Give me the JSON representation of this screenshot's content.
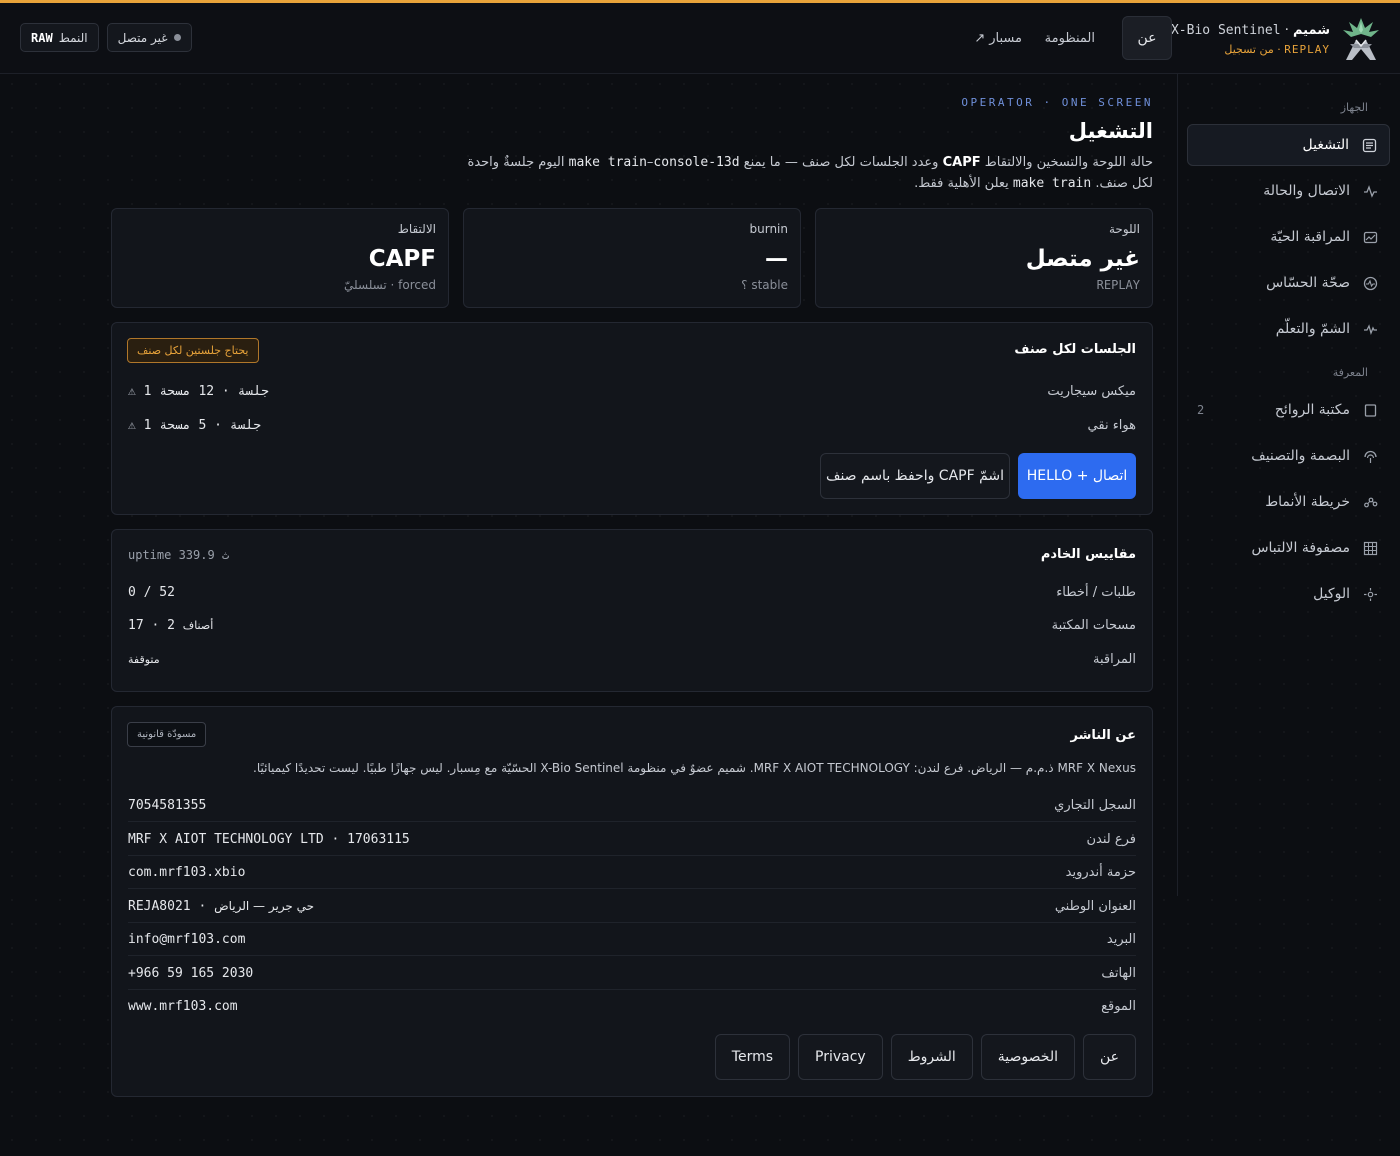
{
  "header": {
    "brand_name": "شميم",
    "brand_separator": "·",
    "brand_product": "X-Bio Sentinel",
    "brand_mode": "REPLAY",
    "brand_mode_sep": "·",
    "brand_mode_note": "من تسجيل",
    "nav_about": "عن",
    "nav_ecosystem": "المنظومة",
    "nav_masar": "مسبار",
    "nav_masar_icon": "↗",
    "status_chip": "غير متصل",
    "mode_chip_label": "النمط",
    "mode_chip_value": "RAW"
  },
  "sidebar": {
    "section_device": "الجهاز",
    "section_knowledge": "المعرفة",
    "items": [
      {
        "label": "التشغيل",
        "icon": "operation-icon"
      },
      {
        "label": "الاتصال والحالة",
        "icon": "pulse-icon"
      },
      {
        "label": "المراقبة الحيّة",
        "icon": "chart-icon"
      },
      {
        "label": "صحّة الحسّاس",
        "icon": "health-icon"
      },
      {
        "label": "الشمّ والتعلّم",
        "icon": "sparkle-icon"
      },
      {
        "label": "مكتبة الروائح",
        "icon": "library-icon",
        "count": "2"
      },
      {
        "label": "البصمة والتصنيف",
        "icon": "fingerprint-icon"
      },
      {
        "label": "خريطة الأنماط",
        "icon": "pattern-icon"
      },
      {
        "label": "مصفوفة الالتباس",
        "icon": "grid-icon"
      },
      {
        "label": "الوكيل",
        "icon": "agent-icon"
      }
    ]
  },
  "page": {
    "eyebrow": "OPERATOR · ONE SCREEN",
    "title": "التشغيل",
    "lead_p1": "حالة اللوحة والتسخين والالتقاط ",
    "lead_bold": "CAPF",
    "lead_p2": " وعدد الجلسات لكل صنف — ما يمنع ",
    "lead_code1": "make train",
    "lead_p3": "–",
    "lead_code2": "console-13d",
    "lead_p4": " اليوم جلسةٌ واحدة لكل صنف. ",
    "lead_code3": "make train",
    "lead_p5": " يعلن الأهلية فقط."
  },
  "stats": {
    "board": {
      "label": "اللوحة",
      "value": "غير متصل",
      "sub": "REPLAY"
    },
    "burnin": {
      "label": "burnin",
      "value": "—",
      "sub": "stable ؟"
    },
    "capture": {
      "label": "الالتقاط",
      "value": "CAPF",
      "sub": "forced · تسلسليّ"
    }
  },
  "sessions": {
    "title": "الجلسات لكل صنف",
    "badge": "يحتاج جلستين لكل صنف",
    "rows": [
      {
        "name": "ميكس سيجاريت",
        "value": "1 جلسة · 12 مسحة",
        "warn": "⚠"
      },
      {
        "name": "هواء نقي",
        "value": "1 جلسة · 5 مسحة",
        "warn": "⚠"
      }
    ],
    "connect_button": "اتصال + HELLO",
    "capture_button": "اشمّ CAPF واحفظ باسم صنف"
  },
  "server": {
    "title": "مقاييس الخادم",
    "uptime": "uptime 339.9 ث",
    "rows": [
      {
        "k": "طلبات / أخطاء",
        "v": "0 / 52"
      },
      {
        "k": "مسحات المكتبة",
        "v": "17 · 2",
        "unit": "أصناف"
      },
      {
        "k": "المراقبة",
        "v": "متوقفة"
      }
    ]
  },
  "about": {
    "title": "عن الناشر",
    "badge": "مسودّة قانونية",
    "text": "MRF X Nexus ذ.م.م — الرياض. فرع لندن: MRF X AIOT TECHNOLOGY. شميم عضوٌ في منظومة X-Bio Sentinel الحسّيّة مع مِسبار. ليس جهازًا طبيًا. ليست تحديدًا كيميائيًا.",
    "rows": [
      {
        "k": "السجل التجاري",
        "v": "7054581355"
      },
      {
        "k": "فرع لندن",
        "v": "MRF X AIOT TECHNOLOGY LTD · 17063115"
      },
      {
        "k": "حزمة أندرويد",
        "v": "com.mrf103.xbio"
      },
      {
        "k": "العنوان الوطني",
        "v": "REJA8021",
        "v_ar": "حي جرير — الرياض"
      },
      {
        "k": "البريد",
        "v": "info@mrf103.com"
      },
      {
        "k": "الهاتف",
        "v": "+966 59 165 2030"
      },
      {
        "k": "الموقع",
        "v": "www.mrf103.com"
      }
    ],
    "links": [
      "عن",
      "الخصوصية",
      "الشروط",
      "Privacy",
      "Terms"
    ]
  },
  "colors": {
    "accent": "#e8a33a",
    "primary": "#2d6bf0",
    "eyebrow": "#6f8fd9",
    "background": "#0c0e12"
  }
}
